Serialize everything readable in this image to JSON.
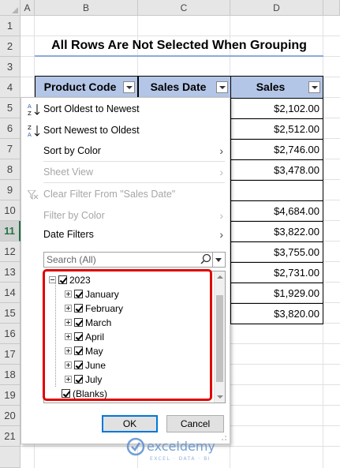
{
  "columns": [
    "A",
    "B",
    "C",
    "D"
  ],
  "rows": [
    "1",
    "2",
    "3",
    "4",
    "5",
    "6",
    "7",
    "8",
    "9",
    "10",
    "11",
    "12",
    "13",
    "14",
    "15",
    "16",
    "17",
    "18",
    "19",
    "20",
    "21"
  ],
  "title": "All Rows Are Not Selected When Grouping",
  "headers": {
    "product_code": "Product Code",
    "sales_date": "Sales Date",
    "sales": "Sales"
  },
  "sales": [
    "$2,102.00",
    "$2,512.00",
    "$2,746.00",
    "$3,478.00",
    "",
    "$4,684.00",
    "$3,822.00",
    "$3,755.00",
    "$2,731.00",
    "$1,929.00",
    "$3,820.00"
  ],
  "menu": {
    "sort_oldest": "Sort Oldest to Newest",
    "sort_newest": "Sort Newest to Oldest",
    "sort_color": "Sort by Color",
    "sheet_view": "Sheet View",
    "clear_filter": "Clear Filter From \"Sales Date\"",
    "filter_color": "Filter by Color",
    "date_filters": "Date Filters",
    "search_placeholder": "Search (All)",
    "year": "2023",
    "months": [
      "January",
      "February",
      "March",
      "April",
      "May",
      "June",
      "July"
    ],
    "blanks": "(Blanks)",
    "ok": "OK",
    "cancel": "Cancel"
  },
  "watermark": {
    "brand": "exceldemy",
    "tagline": "EXCEL · DATA · BI"
  },
  "colors": {
    "header_fill": "#b4c6e7",
    "highlight": "#e00000",
    "excel_green": "#217346"
  }
}
